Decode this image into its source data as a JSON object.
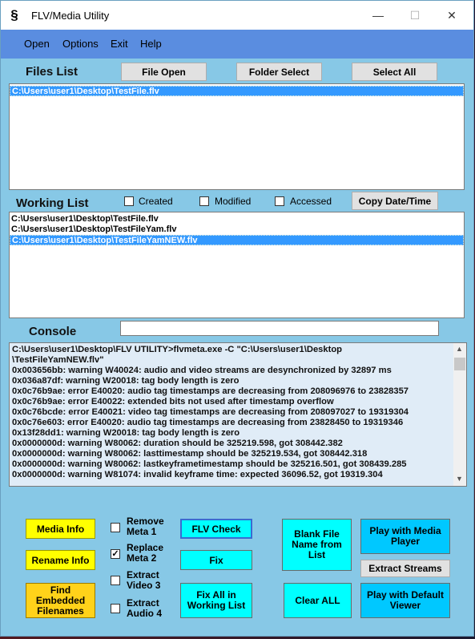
{
  "window": {
    "title": "FLV/Media Utility",
    "icon_glyph": "§",
    "controls": {
      "minimize": "—",
      "maximize": "☐",
      "close": "✕"
    }
  },
  "menu": [
    "Open",
    "Options",
    "Exit",
    "Help"
  ],
  "files_list": {
    "label": "Files List",
    "buttons": {
      "file_open": "File Open",
      "folder_select": "Folder Select",
      "select_all": "Select All"
    },
    "items": [
      "C:\\Users\\user1\\Desktop\\TestFile.flv"
    ]
  },
  "working_list": {
    "label": "Working List",
    "checkboxes": {
      "created": "Created",
      "modified": "Modified",
      "accessed": "Accessed"
    },
    "copy_button": "Copy Date/Time",
    "items": [
      "C:\\Users\\user1\\Desktop\\TestFile.flv",
      "C:\\Users\\user1\\Desktop\\TestFileYam.flv",
      "C:\\Users\\user1\\Desktop\\TestFileYamNEW.flv"
    ]
  },
  "console": {
    "label": "Console",
    "input_value": "",
    "lines": [
      "C:\\Users\\user1\\Desktop\\FLV UTILITY>flvmeta.exe -C \"C:\\Users\\user1\\Desktop",
      "\\TestFileYamNEW.flv\"",
      "0x003656bb: warning W40024: audio and video streams are desynchronized by 32897 ms",
      "0x036a87df: warning W20018: tag body length is zero",
      "0x0c76b9ae: error E40020: audio tag timestamps are decreasing from 208096976 to 23828357",
      "0x0c76b9ae: error E40022: extended bits not used after timestamp overflow",
      "0x0c76bcde: error E40021: video tag timestamps are decreasing from 208097027 to 19319304",
      "0x0c76e603: error E40020: audio tag timestamps are decreasing from 23828450 to 19319346",
      "0x13f28dd1: warning W20018: tag body length is zero",
      "0x0000000d: warning W80062: duration should be 325219.598, got 308442.382",
      "0x0000000d: warning W80062: lasttimestamp should be 325219.534, got 308442.318",
      "0x0000000d: warning W80062: lastkeyframetimestamp should be 325216.501, got 308439.285",
      "0x0000000d: warning W81074: invalid keyframe time: expected 36096.52, got 19319.304"
    ]
  },
  "actions": {
    "media_info": "Media Info",
    "rename_info": "Rename Info",
    "find_embedded": "Find\nEmbedded\nFilenames",
    "remove_meta": "Remove\nMeta  1",
    "replace_meta": "Replace\nMeta  2",
    "extract_video": "Extract\nVideo 3",
    "extract_audio": "Extract\nAudio 4",
    "flv_check": "FLV Check",
    "fix": "Fix",
    "fix_all": "Fix All in\nWorking List",
    "blank_file_name": "Blank File\nName from\nList",
    "clear_all": "Clear ALL",
    "play_media_player": "Play with Media\nPlayer",
    "extract_streams": "Extract Streams",
    "play_default": "Play with Default\nViewer"
  },
  "checkbox_states": {
    "remove_meta": false,
    "replace_meta": true,
    "extract_video": false,
    "extract_audio": false,
    "created": false,
    "modified": false,
    "accessed": false
  }
}
